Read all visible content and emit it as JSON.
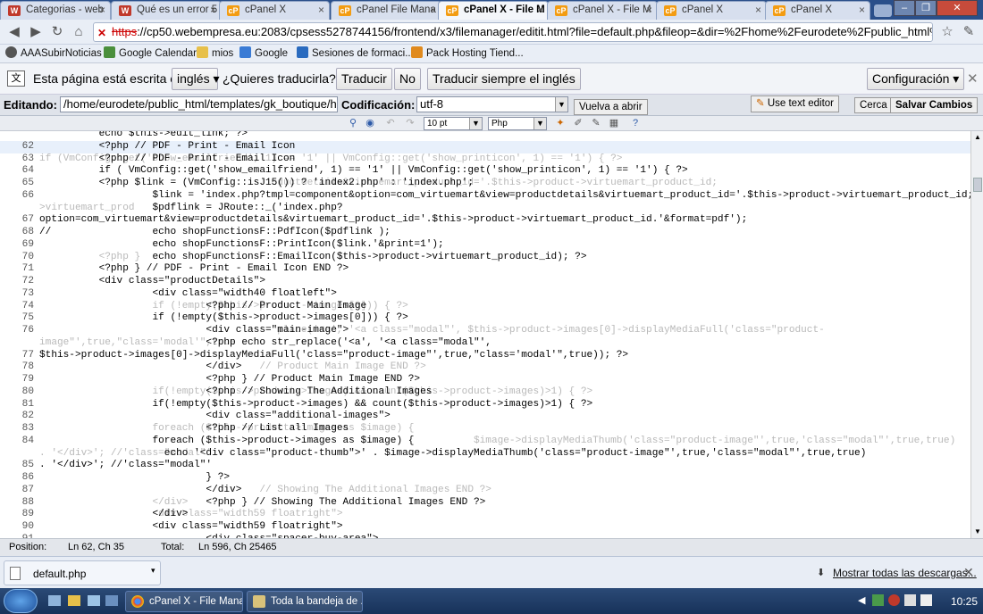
{
  "browser": {
    "tabs": [
      {
        "label": "Categorias - web",
        "icon": "w-favicon",
        "active": false
      },
      {
        "label": "Qué es un error 5",
        "icon": "w-favicon",
        "active": false
      },
      {
        "label": "cPanel X",
        "icon": "cpanel-favicon",
        "active": false
      },
      {
        "label": "cPanel File Mana",
        "icon": "cpanel-favicon",
        "active": false
      },
      {
        "label": "cPanel X - File M",
        "icon": "cpanel-favicon",
        "active": true
      },
      {
        "label": "cPanel X - File M",
        "icon": "cpanel-favicon",
        "active": false
      },
      {
        "label": "cPanel X",
        "icon": "cpanel-favicon",
        "active": false
      },
      {
        "label": "cPanel X",
        "icon": "cpanel-favicon",
        "active": false
      }
    ],
    "url_scheme": "https",
    "url_rest": "://cp50.webempresa.eu:2083/cpsess5278744156/frontend/x3/filemanager/editit.html?file=default.php&fileop=&dir=%2Fhome%2Feurodete%2Fpublic_html%",
    "bookmarks": [
      "AAASubirNoticias",
      "Google Calendar",
      "mios",
      "Google",
      "Sesiones de formaci...",
      "Pack Hosting Tiend..."
    ]
  },
  "translate_bar": {
    "prefix": "Esta página está escrita en",
    "language": "inglés",
    "question": "¿Quieres traducirla?",
    "translate_button": "Traducir",
    "no_button": "No",
    "always_button": "Traducir siempre el inglés",
    "config_button": "Configuración"
  },
  "editor": {
    "editing_label": "Editando:",
    "file_path": "/home/eurodete/public_html/templates/gk_boutique/h",
    "encoding_label": "Codificación:",
    "encoding_value": "utf-8",
    "reopen_button": "Vuelva a abrir",
    "use_text_editor": "Use text editor",
    "close_button": "Cerca",
    "save_button": "Salvar Cambios",
    "font_size": "10 pt",
    "syntax": "Php"
  },
  "code_lines": [
    {
      "n": "",
      "t": "          echo $this->edit_link; ?>",
      "g": ""
    },
    {
      "n": "62",
      "t": "          <?php // PDF - Print - Email Icon",
      "g": ""
    },
    {
      "n": "63",
      "t": "          <?php // PDF - Print - Email Icon",
      "g": "if (VmConfig::get('show_emailfriend', 1) == '1' || VmConfig::get('show_printicon', 1) == '1') { ?>"
    },
    {
      "n": "64",
      "t": "          if ( VmConfig::get('show_emailfriend', 1) == '1' || VmConfig::get('show_printicon', 1) == '1') { ?>",
      "g": ""
    },
    {
      "n": "65",
      "t": "          <?php $link = (VmConfig::isJ15()) ? 'index2.php' : 'index.php';",
      "g": "                                       oductdetails&virtuemart_product_id='.$this->product->virtuemart_product_id;"
    },
    {
      "n": "66",
      "t": "                   $link = 'index.php?tmpl=component&option=com_virtuemart&view=productdetails&virtuemart_product_id='.$this->product->virtuemart_product_id;",
      "g": ""
    },
    {
      "n": "",
      "t": "                   $pdflink = JRoute::_('index.php?",
      "g": ">virtuemart_prod"
    },
    {
      "n": "67",
      "t": "option=com_virtuemart&view=productdetails&virtuemart_product_id='.$this->product->virtuemart_product_id.'&format=pdf');",
      "g": ""
    },
    {
      "n": "68",
      "t": "//                 echo shopFunctionsF::PdfIcon($pdflink );",
      "g": ""
    },
    {
      "n": "69",
      "t": "                   echo shopFunctionsF::PrintIcon($link.'&print=1');",
      "g": ""
    },
    {
      "n": "70",
      "t": "                   echo shopFunctionsF::EmailIcon($this->product->virtuemart_product_id); ?>",
      "g": "          <?php }"
    },
    {
      "n": "71",
      "t": "          <?php } // PDF - Print - Email Icon END ?>",
      "g": ""
    },
    {
      "n": "72",
      "t": "          <div class=\"productDetails\">",
      "g": ""
    },
    {
      "n": "73",
      "t": "                   <div class=\"width40 floatleft\">",
      "g": ""
    },
    {
      "n": "74",
      "t": "                            <?php // Product Main Image",
      "g": "                   if (!empty($this->product->images[0])) { ?>"
    },
    {
      "n": "75",
      "t": "                   if (!empty($this->product->images[0])) { ?>",
      "g": ""
    },
    {
      "n": "76",
      "t": "                            <div class=\"main-image\">",
      "g": "                                        place('<a', '<a class=\"modal\"', $this->product->images[0]->displayMediaFull('class=\"product-"
    },
    {
      "n": "",
      "t": "                            <?php echo str_replace('<a', '<a class=\"modal\"',",
      "g": "image\"',true,\"class='modal'\",true"
    },
    {
      "n": "77",
      "t": "$this->product->images[0]->displayMediaFull('class=\"product-image\"',true,\"class='modal'\",true)); ?>",
      "g": ""
    },
    {
      "n": "78",
      "t": "                            </div>",
      "g": "                                     // Product Main Image END ?>"
    },
    {
      "n": "79",
      "t": "                            <?php } // Product Main Image END ?>",
      "g": ""
    },
    {
      "n": "80",
      "t": "                            <?php // Showing The Additional Images",
      "g": "                   if(!empty($this->product->images) && count($this->product->images)>1) { ?>"
    },
    {
      "n": "81",
      "t": "                   if(!empty($this->product->images) && count($this->product->images)>1) { ?>",
      "g": ""
    },
    {
      "n": "82",
      "t": "                            <div class=\"additional-images\">",
      "g": ""
    },
    {
      "n": "83",
      "t": "                            <?php // List all Images",
      "g": "                   foreach ($this->product->images as $image) {"
    },
    {
      "n": "84",
      "t": "                   foreach ($this->product->images as $image) {",
      "g": "                                                                         $image->displayMediaThumb('class=\"product-image\"',true,'class=\"modal\"',true,true)"
    },
    {
      "n": "",
      "t": "                     echo '<div class=\"product-thumb\">' . $image->displayMediaThumb('class=\"product-image\"',true,'class=\"modal\"',true,true)",
      "g": ". '</div>'; //'class=\"modal\"'"
    },
    {
      "n": "85",
      "t": ". '</div>'; //'class=\"modal\"'",
      "g": ""
    },
    {
      "n": "86",
      "t": "                            } ?>",
      "g": ""
    },
    {
      "n": "87",
      "t": "                            </div>",
      "g": "                                     // Showing The Additional Images END ?>"
    },
    {
      "n": "88",
      "t": "                            <?php } // Showing The Additional Images END ?>",
      "g": "                   </div>"
    },
    {
      "n": "89",
      "t": "                   </div>",
      "g": "                   <div class=\"width59 floatright\">"
    },
    {
      "n": "90",
      "t": "                   <div class=\"width59 floatright\">",
      "g": ""
    },
    {
      "n": "91",
      "t": "                            <div class=\"spacer-buy-area\">",
      "g": ""
    }
  ],
  "status": {
    "position_label": "Position:",
    "position_value": "Ln 62, Ch 35",
    "total_label": "Total:",
    "total_value": "Ln 596, Ch 25465"
  },
  "downloads": {
    "file": "default.php",
    "show_all": "Mostrar todas las descargas..."
  },
  "taskbar": {
    "items": [
      "cPanel X - File Mana...",
      "Toda la bandeja de ..."
    ],
    "clock": "10:25"
  }
}
